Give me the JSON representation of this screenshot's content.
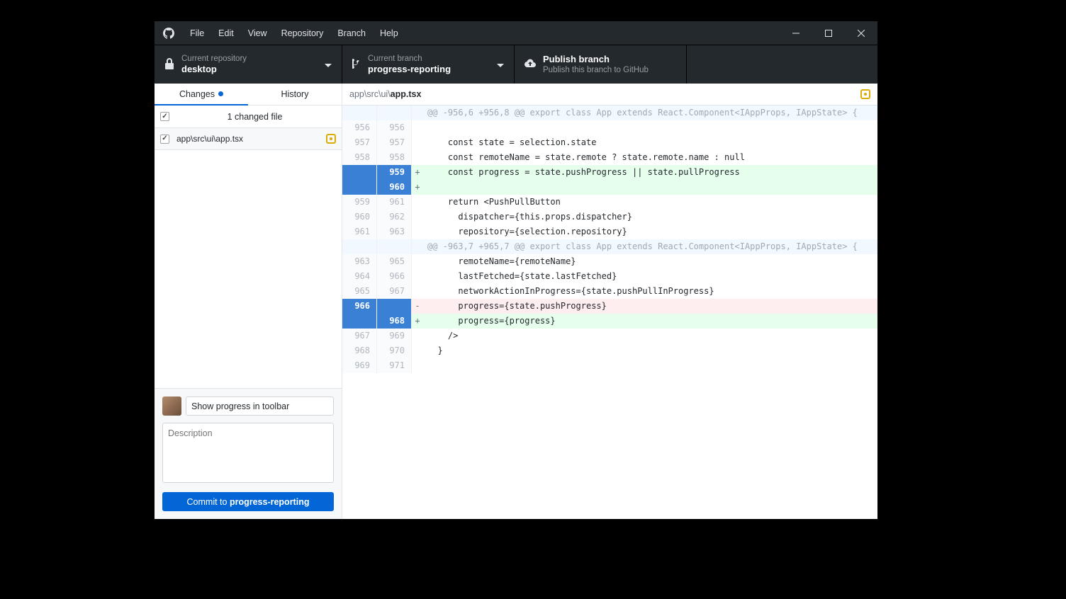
{
  "menu": [
    "File",
    "Edit",
    "View",
    "Repository",
    "Branch",
    "Help"
  ],
  "toolbar": {
    "repo": {
      "label": "Current repository",
      "value": "desktop"
    },
    "branch": {
      "label": "Current branch",
      "value": "progress-reporting"
    },
    "publish": {
      "title": "Publish branch",
      "subtitle": "Publish this branch to GitHub"
    }
  },
  "tabs": {
    "changes": "Changes",
    "history": "History"
  },
  "changes": {
    "summary": "1 changed file"
  },
  "file": {
    "path": "app\\src\\ui\\app.tsx"
  },
  "commit": {
    "summary_value": "Show progress in toolbar",
    "desc_placeholder": "Description",
    "btn_prefix": "Commit to ",
    "btn_branch": "progress-reporting"
  },
  "diff": {
    "path_prefix": "app\\src\\ui\\",
    "path_file": "app.tsx",
    "lines": [
      {
        "t": "hunk",
        "o": "",
        "n": "",
        "m": "",
        "c": "@@ -956,6 +956,8 @@ export class App extends React.Component<IAppProps, IAppState> {"
      },
      {
        "t": "ctx",
        "o": "956",
        "n": "956",
        "m": "",
        "c": ""
      },
      {
        "t": "ctx",
        "o": "957",
        "n": "957",
        "m": "",
        "c": "    const state = selection.state"
      },
      {
        "t": "ctx",
        "o": "958",
        "n": "958",
        "m": "",
        "c": "    const remoteName = state.remote ? state.remote.name : null"
      },
      {
        "t": "add",
        "o": "",
        "n": "959",
        "m": "+",
        "c": "    const progress = state.pushProgress || state.pullProgress"
      },
      {
        "t": "add",
        "o": "",
        "n": "960",
        "m": "+",
        "c": ""
      },
      {
        "t": "ctx",
        "o": "959",
        "n": "961",
        "m": "",
        "c": "    return <PushPullButton"
      },
      {
        "t": "ctx",
        "o": "960",
        "n": "962",
        "m": "",
        "c": "      dispatcher={this.props.dispatcher}"
      },
      {
        "t": "ctx",
        "o": "961",
        "n": "963",
        "m": "",
        "c": "      repository={selection.repository}"
      },
      {
        "t": "hunk",
        "o": "",
        "n": "",
        "m": "",
        "c": "@@ -963,7 +965,7 @@ export class App extends React.Component<IAppProps, IAppState> {"
      },
      {
        "t": "ctx",
        "o": "963",
        "n": "965",
        "m": "",
        "c": "      remoteName={remoteName}"
      },
      {
        "t": "ctx",
        "o": "964",
        "n": "966",
        "m": "",
        "c": "      lastFetched={state.lastFetched}"
      },
      {
        "t": "ctx",
        "o": "965",
        "n": "967",
        "m": "",
        "c": "      networkActionInProgress={state.pushPullInProgress}"
      },
      {
        "t": "del",
        "o": "966",
        "n": "",
        "m": "-",
        "c": "      progress={state.pushProgress}"
      },
      {
        "t": "add",
        "o": "",
        "n": "968",
        "m": "+",
        "c": "      progress={progress}"
      },
      {
        "t": "ctx",
        "o": "967",
        "n": "969",
        "m": "",
        "c": "    />"
      },
      {
        "t": "ctx",
        "o": "968",
        "n": "970",
        "m": "",
        "c": "  }"
      },
      {
        "t": "ctx",
        "o": "969",
        "n": "971",
        "m": "",
        "c": ""
      }
    ]
  }
}
